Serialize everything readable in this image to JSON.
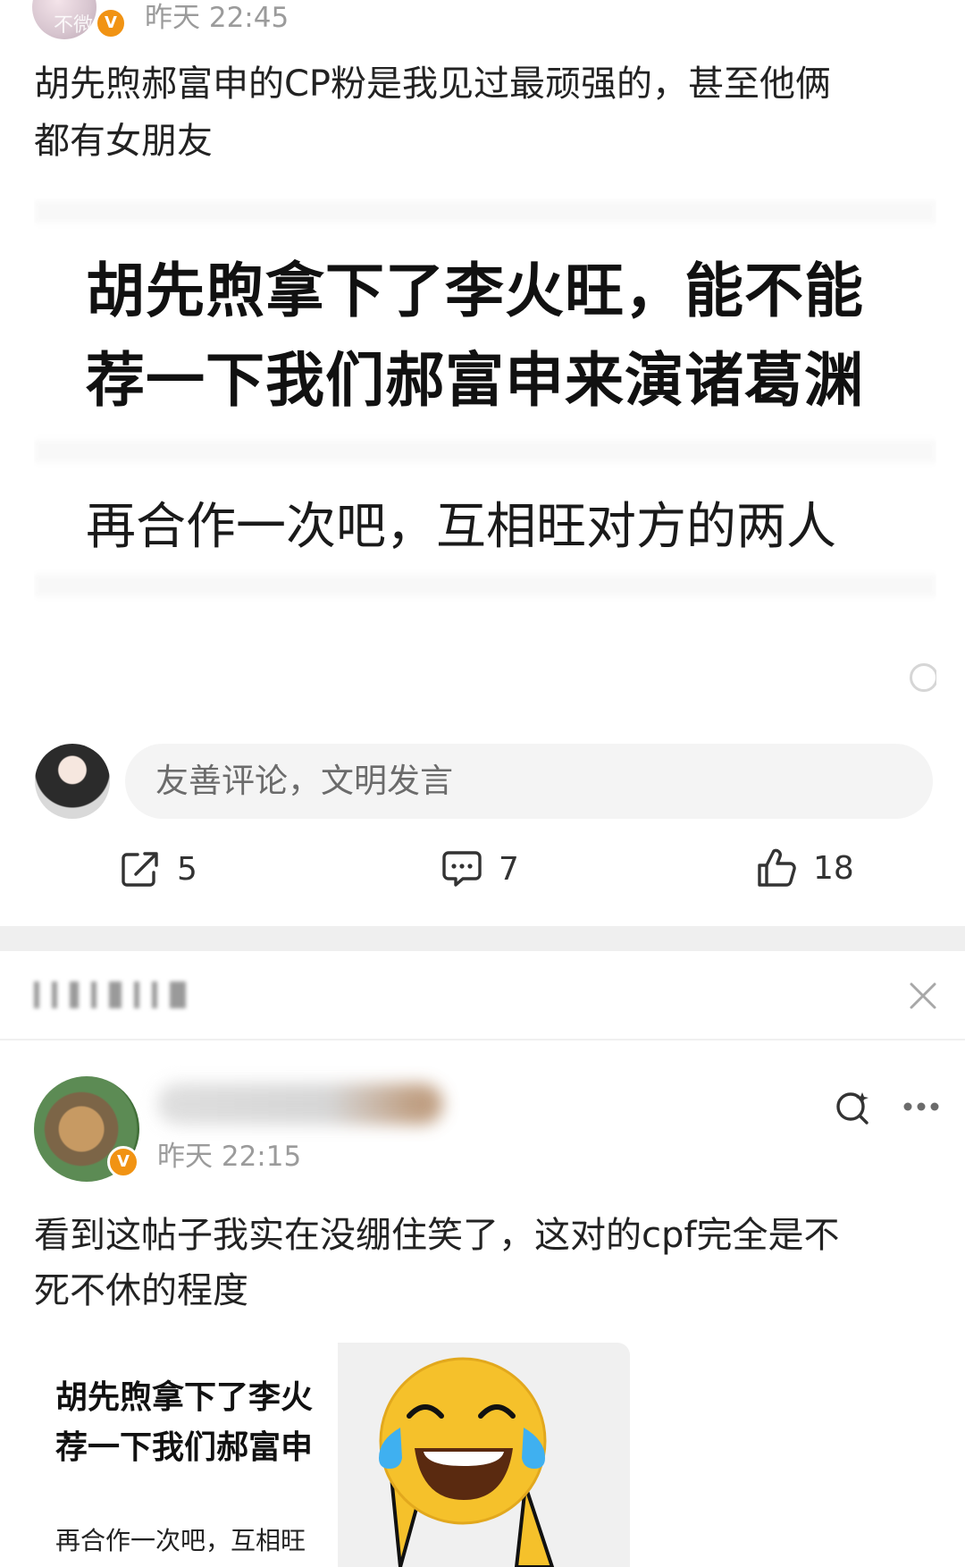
{
  "post1": {
    "author_avatar_text": "不微",
    "time": "昨天 22:45",
    "text_line1": "胡先煦郝富申的CP粉是我见过最顽强的，甚至他俩",
    "text_line2": "都有女朋友",
    "image": {
      "line1": "胡先煦拿下了李火旺，能不能",
      "line2": "荐一下我们郝富申来演诸葛渊",
      "line3": "再合作一次吧，互相旺对方的两人"
    },
    "comment_placeholder": "友善评论，文明发言",
    "actions": {
      "share_count": "5",
      "comment_count": "7",
      "like_count": "18"
    }
  },
  "recommend": {
    "close_icon": "close-icon"
  },
  "post2": {
    "time": "昨天 22:15",
    "text_line1": "看到这帖子我实在没绷住笑了，这对的cpf完全是不",
    "text_line2": "死不休的程度",
    "thumb": {
      "line1": "胡先煦拿下了李火",
      "line2": "荐一下我们郝富申",
      "line3": "再合作一次吧，互相旺"
    }
  },
  "colors": {
    "verified_badge": "#f19313",
    "emoji_yellow": "#f5c12b",
    "emoji_tears": "#3fb0f0"
  }
}
